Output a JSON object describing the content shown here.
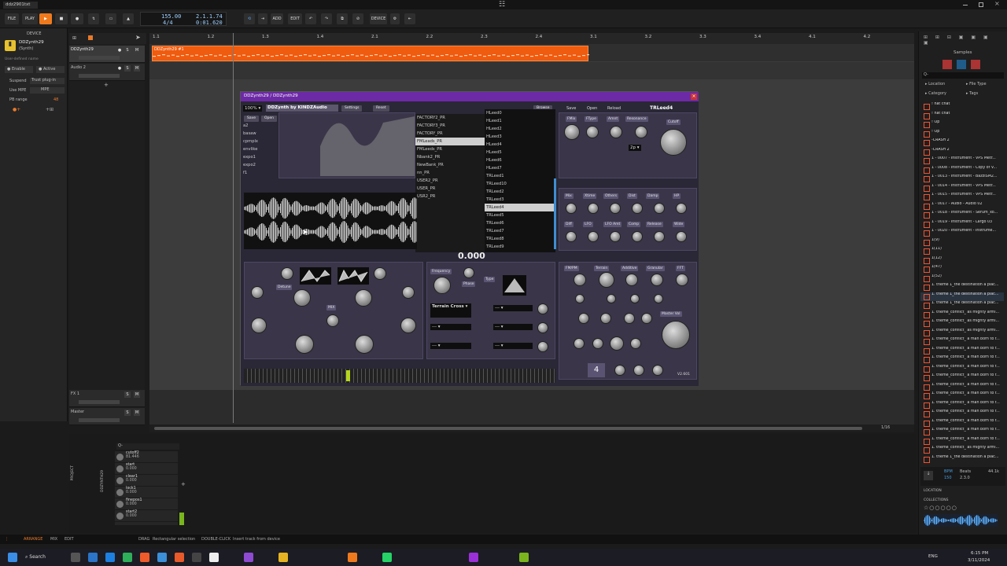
{
  "window": {
    "tab": "ddz2901txt",
    "logo_glyph": "☷"
  },
  "toolbar": {
    "file": "FILE",
    "play": "PLAY",
    "tempo": "155.00",
    "time_sig": "4/4",
    "position": "2.1.1.74",
    "time": "0:01.620",
    "add": "ADD",
    "edit": "EDIT",
    "device": "DEVICE"
  },
  "left_panel": {
    "header": "DEVICE",
    "device_name": "DDZynth29",
    "device_sub": "(Synth)",
    "user_defined": "User-defined name",
    "enable": "Enable",
    "active": "Active",
    "suspend_label": "Suspend",
    "suspend_value": "Trust plug-in",
    "use_mpe_label": "Use MPE",
    "use_mpe_value": "MPE",
    "pb_range_label": "PB range",
    "pb_range_value": "48"
  },
  "tracks": [
    {
      "name": "DDZynth29"
    },
    {
      "name": "Audio 2"
    },
    {
      "name": "FX 1"
    },
    {
      "name": "Master"
    }
  ],
  "ruler": [
    "1.1",
    "1.2",
    "1.3",
    "1.4",
    "2.1",
    "2.2",
    "2.3",
    "2.4",
    "3.1",
    "3.2",
    "3.3",
    "3.4",
    "4.1",
    "4.2"
  ],
  "clip": {
    "label": "DDZynth29 #1"
  },
  "plugin": {
    "title": "DDZynth29 / DDZynth29",
    "zoom": "100%",
    "brand": "DDZynth by KINDZAudio",
    "settings": "Settings",
    "reset": "Reset",
    "browse": "Browse",
    "save": "Save",
    "open": "Open",
    "reload": "Reload",
    "preset_name": "TRLeed4",
    "left_presets": [
      "a2",
      "basaw",
      "cpmplx",
      "envlike",
      "expo1",
      "expo2",
      "f1"
    ],
    "banks": [
      "FACTORY2_PR",
      "FACTORY3_PR",
      "FACTORY_PR",
      "FMLeads_PR",
      "FMLeeds_PR",
      "Nbank2_PR",
      "NewBank_PR",
      "nn_PR",
      "USER2_PR",
      "USER_PR",
      "USR2_PR"
    ],
    "bank_selected": 3,
    "patches": [
      "HLeed0",
      "HLeed1",
      "HLeed2",
      "HLeed3",
      "HLeed4",
      "HLeed5",
      "HLeed6",
      "HLeed7",
      "TRLeed1",
      "TRLeed10",
      "TRLeed2",
      "TRLeed3",
      "TRLeed4",
      "TRLeed5",
      "TRLeed6",
      "TRLeed7",
      "TRLeed8",
      "TRLeed9"
    ],
    "patch_selected": 12,
    "value_display": "0.000",
    "terrain": "Terrain Cross",
    "dashes": "---",
    "filter_mode": "2p",
    "version": "V2.601",
    "voices": "4",
    "panel_labels": {
      "fmix": "FMix",
      "ftype": "FType",
      "amnt": "Amnt",
      "resonance": "Resonance",
      "cutoff": "Cutoff",
      "mix": "Mix",
      "xtime": "Xtime",
      "others": "Others",
      "dist": "Dist",
      "damp": "Damp",
      "hp": "HP",
      "diff": "Diff",
      "lfo": "LFO",
      "lfo_amt": "LFO Amt",
      "comp": "Comp",
      "release": "Release",
      "wide": "Wide",
      "fm_pm": "FM/PM",
      "terrain_lbl": "Terrain",
      "additive": "Additive",
      "granular": "Granular",
      "fft": "FFT",
      "master_vol": "Master Vol",
      "frequency": "Frequency",
      "type": "Type",
      "phase": "Phase",
      "detune": "Detune",
      "mix2": "MIX"
    }
  },
  "samples": {
    "header": "Samples",
    "search_glyph": "Q-",
    "location": "Location",
    "file_type": "File Type",
    "category": "Category",
    "tags": "Tags",
    "items": [
      "! hat chat",
      "! hat chat",
      "! Op",
      "! Op",
      "-CRASH 2",
      "-CRASH 2",
      "1 - 0007 - Instrument - VPS Metr...",
      "1 - 0008 - Instrument - Copy of V...",
      "1 - 0013 - Instrument - BazzISM2...",
      "1 - 0014 - Instrument - VPS Metr...",
      "1 - 0015 - Instrument - VPS Metr...",
      "1 - 0017 - Audio - Audio 02",
      "1 - 0018 - Instrument - Serum_xo...",
      "1 - 0019 - Instrument - Largo 03",
      "1 - 0020 - Instrument - Instrume...",
      "1(9)",
      "1(11)",
      "1(12)",
      "1(47)",
      "1(52)",
      "1. theme 1_the destination a plac...",
      "1. theme 1_the destination a plac...",
      "1. theme 1_the destination a plac...",
      "1. theme_conflict_ as mighty armi...",
      "1. theme_conflict_ as mighty armi...",
      "1. theme_conflict_ as mighty armi...",
      "1. theme_conflict_ a man born to f...",
      "1. theme_conflict_ a man born to f...",
      "1. theme_conflict_ a man born to f...",
      "1. theme_conflict_ a man born to f...",
      "1. theme_conflict_ a man born to f...",
      "1. theme_conflict_ a man born to f...",
      "1. theme_conflict_ a man born to f...",
      "1. theme_conflict_ a man born to f...",
      "1. theme_conflict_ a man born to f...",
      "1. theme_conflict_ a man born to f...",
      "1. theme_conflict_ a man born to f...",
      "1. theme_conflict_ a man born to f...",
      "1. theme_conflict_ as mighty armi...",
      "1. theme 1_the destination a plac..."
    ],
    "selected_index": 21,
    "bpm_label": "BPM",
    "bpm_value": "150",
    "beats_label": "Beats",
    "beats_value": "2.3.0",
    "rate": "44.1k",
    "location_footer": "LOCATION",
    "collections": "COLLECTIONS"
  },
  "arranger_footer": {
    "zoom": "1/16"
  },
  "modulators": {
    "search_glyph": "Q-",
    "project": "PROJECT",
    "track": "DDZYNTH29",
    "params": [
      {
        "name": "cutoff2",
        "value": "81.446"
      },
      {
        "name": "start",
        "value": "0.000"
      },
      {
        "name": "clear1",
        "value": "0.000"
      },
      {
        "name": "lock1",
        "value": "0.000"
      },
      {
        "name": "finepos1",
        "value": "0.000"
      },
      {
        "name": "start2",
        "value": "0.000"
      }
    ]
  },
  "status": {
    "arrange": "ARRANGE",
    "mix": "MIX",
    "edit": "EDIT",
    "drag": "DRAG",
    "drag_desc": "Rectangular selection",
    "double_click": "DOUBLE-CLICK",
    "double_desc": "Insert track from device"
  },
  "taskbar": {
    "search": "Search",
    "lang": "ENG",
    "time": "6:15 PM",
    "date": "3/11/2024"
  }
}
